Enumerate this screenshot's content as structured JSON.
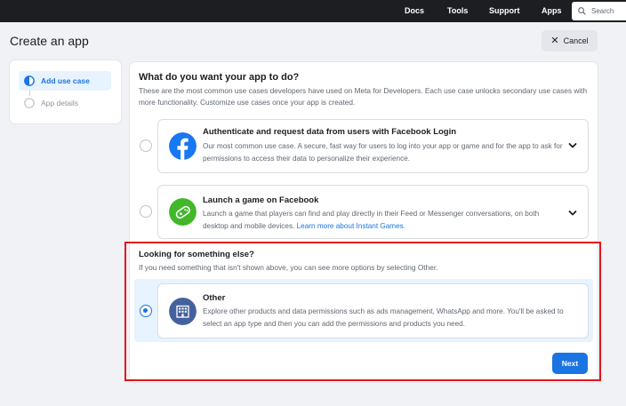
{
  "nav": {
    "links": [
      "Docs",
      "Tools",
      "Support",
      "Apps"
    ],
    "search_placeholder": "Search"
  },
  "header": {
    "title": "Create an app",
    "cancel_label": "Cancel"
  },
  "steps": [
    {
      "label": "Add use case",
      "state": "active"
    },
    {
      "label": "App details",
      "state": "inactive"
    }
  ],
  "main": {
    "question": "What do you want your app to do?",
    "description": "These are the most common use cases developers have used on Meta for Developers. Each use case unlocks secondary use cases with more functionality. Customize use cases once your app is created.",
    "options": [
      {
        "title": "Authenticate and request data from users with Facebook Login",
        "description": "Our most common use case. A secure, fast way for users to log into your app or game and for the app to ask for permissions to access their data to personalize their experience.",
        "icon": "facebook-icon",
        "selected": false
      },
      {
        "title": "Launch a game on Facebook",
        "description": "Launch a game that players can find and play directly in their Feed or Messenger conversations, on both desktop and mobile devices.",
        "link_text": "Learn more about Instant Games.",
        "icon": "gamepad-icon",
        "selected": false
      }
    ],
    "else_title": "Looking for something else?",
    "else_description": "If you need something that isn't shown above, you can see more options by selecting Other.",
    "other": {
      "title": "Other",
      "description": "Explore other products and data permissions such as ads management, WhatsApp and more. You'll be asked to select an app type and then you can add the permissions and products you need.",
      "icon": "building-icon",
      "selected": true
    },
    "next_label": "Next"
  },
  "colors": {
    "accent": "#1b74e4",
    "nav_bg": "#1c1e21",
    "highlight": "#e4141b",
    "selected_bg": "#e7f3ff"
  }
}
